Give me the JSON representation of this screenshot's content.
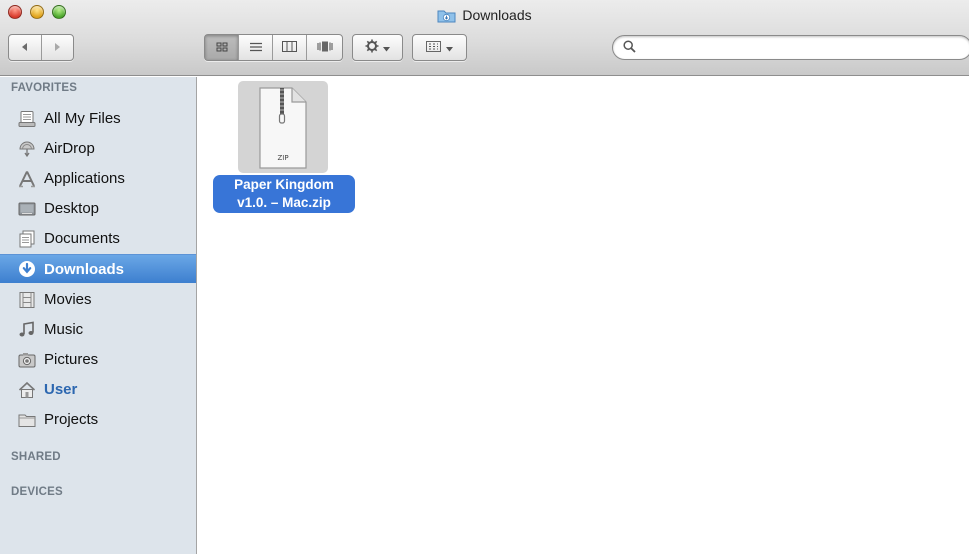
{
  "window": {
    "title": "Downloads",
    "colors": {
      "selection": "#3875d7",
      "sidebar_bg": "#dde4eb",
      "sidebar_selected": "#4a8ad8",
      "user_link": "#2c67b0"
    }
  },
  "toolbar": {
    "back_icon": "back-icon",
    "forward_icon": "forward-icon",
    "view_modes": [
      "icon-view-icon",
      "list-view-icon",
      "column-view-icon",
      "coverflow-view-icon"
    ],
    "active_view": "icon-view",
    "action_icon": "gear-icon",
    "arrange_icon": "arrange-icon",
    "search": {
      "value": "",
      "placeholder": ""
    }
  },
  "sidebar": {
    "sections": {
      "favorites": "FAVORITES",
      "shared": "SHARED",
      "devices": "DEVICES"
    },
    "items": [
      {
        "label": "All My Files",
        "icon": "all-my-files-icon"
      },
      {
        "label": "AirDrop",
        "icon": "airdrop-icon"
      },
      {
        "label": "Applications",
        "icon": "applications-icon"
      },
      {
        "label": "Desktop",
        "icon": "desktop-icon"
      },
      {
        "label": "Documents",
        "icon": "documents-icon"
      },
      {
        "label": "Downloads",
        "icon": "downloads-icon",
        "selected": true
      },
      {
        "label": "Movies",
        "icon": "movies-icon"
      },
      {
        "label": "Music",
        "icon": "music-icon"
      },
      {
        "label": "Pictures",
        "icon": "pictures-icon"
      },
      {
        "label": "User",
        "icon": "home-icon"
      },
      {
        "label": "Projects",
        "icon": "folder-icon"
      }
    ]
  },
  "files": [
    {
      "name_line1": "Paper Kingdom",
      "name_line2": "v1.0.   – Mac.zip",
      "type_badge": "ZIP",
      "icon": "zip-file-icon",
      "selected": true
    }
  ]
}
